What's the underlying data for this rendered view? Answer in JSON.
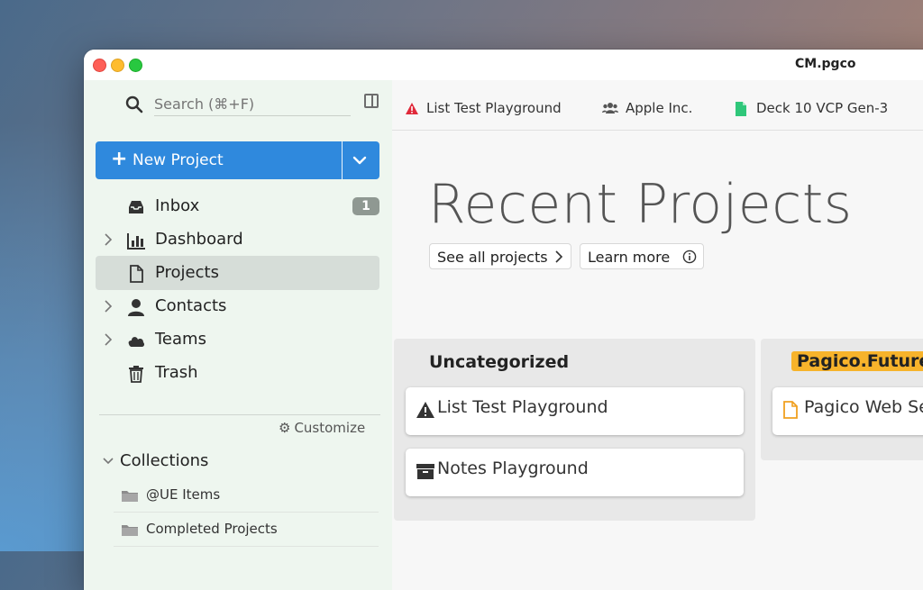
{
  "window": {
    "title": "CM.pgco"
  },
  "sidebar": {
    "search_placeholder": "Search (⌘+F)",
    "new_project_label": "New Project",
    "nav": [
      {
        "label": "Inbox",
        "icon": "inbox-icon",
        "badge": "1",
        "expandable": false,
        "active": false
      },
      {
        "label": "Dashboard",
        "icon": "bar-chart-icon",
        "expandable": true,
        "active": false
      },
      {
        "label": "Projects",
        "icon": "document-icon",
        "expandable": false,
        "active": true
      },
      {
        "label": "Contacts",
        "icon": "person-icon",
        "expandable": true,
        "active": false
      },
      {
        "label": "Teams",
        "icon": "cloud-icon",
        "expandable": true,
        "active": false
      },
      {
        "label": "Trash",
        "icon": "trash-icon",
        "expandable": false,
        "active": false
      }
    ],
    "customize_label": "Customize",
    "collections": {
      "label": "Collections",
      "items": [
        {
          "label": "@UE Items"
        },
        {
          "label": "Completed Projects"
        }
      ]
    }
  },
  "tabs": [
    {
      "label": "List Test Playground",
      "icon": "warning-icon",
      "icon_color": "#e0293a"
    },
    {
      "label": "Apple Inc.",
      "icon": "people-icon",
      "icon_color": "#555555"
    },
    {
      "label": "Deck 10 VCP Gen-3",
      "icon": "document-icon",
      "icon_color": "#2fc77a"
    }
  ],
  "main": {
    "title": "Recent Projects",
    "see_all_label": "See all projects",
    "learn_more_label": "Learn more",
    "columns": [
      {
        "title": "Uncategorized",
        "cards": [
          {
            "label": "List Test Playground",
            "icon": "warning-icon"
          },
          {
            "label": "Notes Playground",
            "icon": "archive-box-icon"
          }
        ]
      },
      {
        "title": "Pagico.Future",
        "highlight_color": "#f7b32b",
        "cards": [
          {
            "label": "Pagico Web Se",
            "icon": "document-icon"
          }
        ]
      }
    ]
  },
  "colors": {
    "accent": "#2f89dd",
    "sidebar_bg": "#eef6ef",
    "badge": "#8f9892"
  }
}
